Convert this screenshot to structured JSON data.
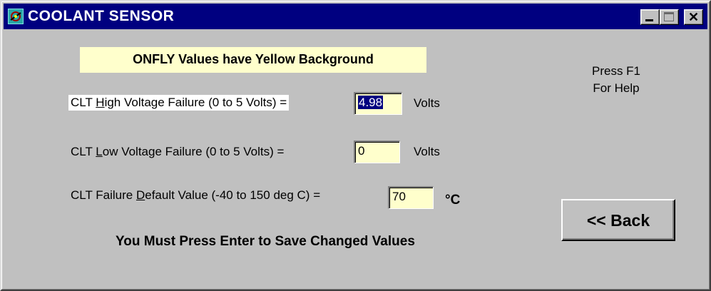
{
  "window": {
    "title": "COOLANT SENSOR",
    "icon": "app-icon",
    "controls": {
      "minimize_icon": "minimize-icon",
      "maximize_icon": "maximize-icon",
      "close_symbol": "✕"
    }
  },
  "banner": "ONFLY Values have Yellow Background",
  "help": {
    "line1": "Press F1",
    "line2": "For Help"
  },
  "fields": {
    "high_voltage": {
      "label_pre": "CLT ",
      "label_key": "H",
      "label_post": "igh Voltage Failure (0 to 5 Volts) =",
      "value": "4.98",
      "unit": "Volts"
    },
    "low_voltage": {
      "label_pre": "CLT ",
      "label_key": "L",
      "label_post": "ow Voltage Failure (0 to 5 Volts) =",
      "value": "0",
      "unit": "Volts"
    },
    "default_value": {
      "label_pre": "CLT Failure ",
      "label_key": "D",
      "label_post": "efault Value (-40 to 150 deg C) =",
      "value": "70",
      "unit": "°C"
    }
  },
  "back_button": "<< Back",
  "save_note": "You Must Press Enter to Save Changed Values",
  "colors": {
    "title_bar": "#000080",
    "onfly_background": "#ffffcc",
    "dialog_background": "#c0c0c0"
  }
}
